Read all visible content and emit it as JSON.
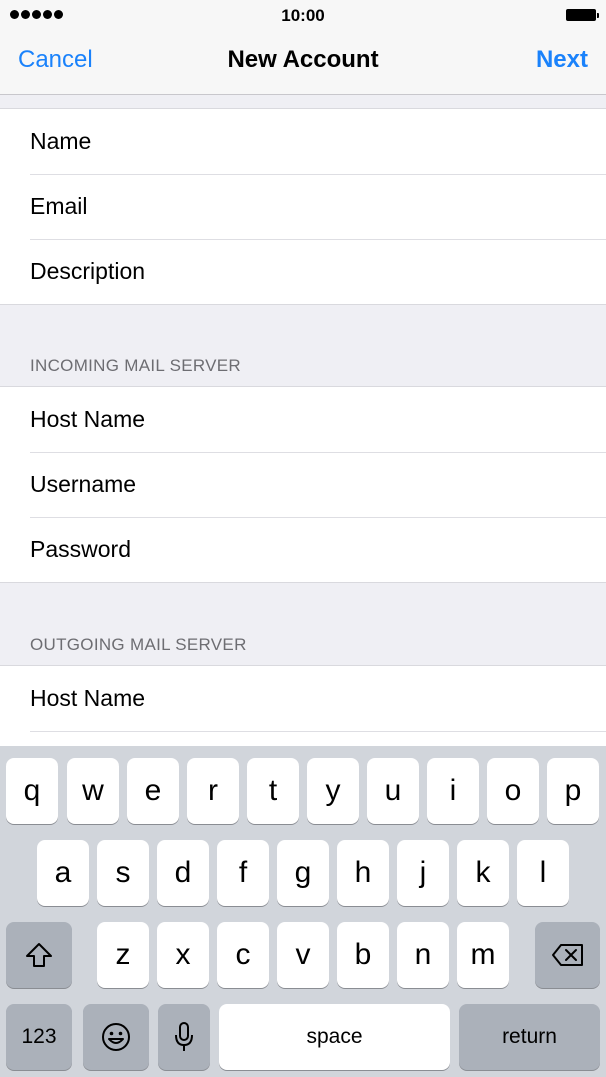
{
  "status_bar": {
    "time": "10:00"
  },
  "nav": {
    "cancel": "Cancel",
    "title": "New Account",
    "next": "Next"
  },
  "account_fields": [
    "Name",
    "Email",
    "Description"
  ],
  "incoming": {
    "header": "INCOMING MAIL SERVER",
    "fields": [
      "Host Name",
      "Username",
      "Password"
    ]
  },
  "outgoing": {
    "header": "OUTGOING MAIL SERVER",
    "fields": [
      "Host Name"
    ]
  },
  "keyboard": {
    "row1": [
      "q",
      "w",
      "e",
      "r",
      "t",
      "y",
      "u",
      "i",
      "o",
      "p"
    ],
    "row2": [
      "a",
      "s",
      "d",
      "f",
      "g",
      "h",
      "j",
      "k",
      "l"
    ],
    "row3": [
      "z",
      "x",
      "c",
      "v",
      "b",
      "n",
      "m"
    ],
    "numbers_label": "123",
    "space_label": "space",
    "return_label": "return"
  }
}
